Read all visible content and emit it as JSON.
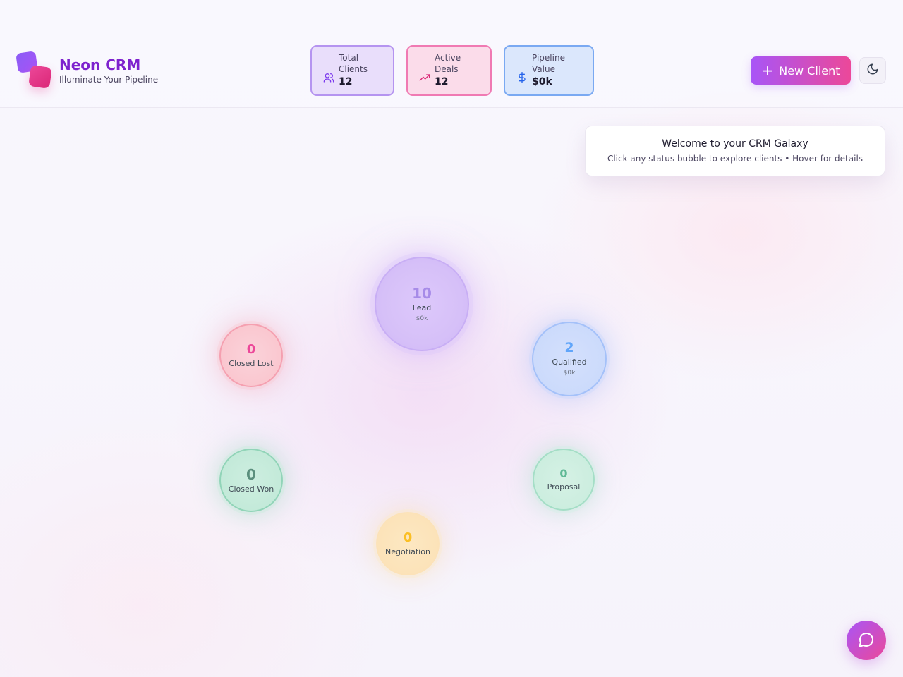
{
  "brand": {
    "name": "Neon CRM",
    "tagline": "Illuminate Your Pipeline"
  },
  "stats": [
    {
      "label": "Total Clients",
      "value": "12",
      "icon": "users-icon"
    },
    {
      "label": "Active Deals",
      "value": "12",
      "icon": "trending-up-icon"
    },
    {
      "label": "Pipeline Value",
      "value": "$0k",
      "icon": "dollar-icon"
    }
  ],
  "header": {
    "new_client_label": "New Client",
    "theme_toggle_icon": "moon-icon"
  },
  "welcome": {
    "title": "Welcome to your CRM Galaxy",
    "subtitle": "Click any status bubble to explore clients • Hover for details"
  },
  "bubbles": {
    "lead": {
      "count": "10",
      "name": "Lead",
      "amount": "$0k",
      "color": "#a78be8"
    },
    "qualified": {
      "count": "2",
      "name": "Qualified",
      "amount": "$0k",
      "color": "#60a5fa"
    },
    "closed_lost": {
      "count": "0",
      "name": "Closed Lost",
      "color": "#ec4899"
    },
    "closed_won": {
      "count": "0",
      "name": "Closed Won",
      "color": "#5b8f7d"
    },
    "proposal": {
      "count": "0",
      "name": "Proposal",
      "color": "#5fb996"
    },
    "negotiation": {
      "count": "0",
      "name": "Negotiation",
      "color": "#fbbf24"
    }
  },
  "chat": {
    "icon": "chat-bubble-icon"
  },
  "colors": {
    "brand_purple": "#7e22ce",
    "accent_gradient_start": "#a855f7",
    "accent_gradient_end": "#ec4899"
  }
}
